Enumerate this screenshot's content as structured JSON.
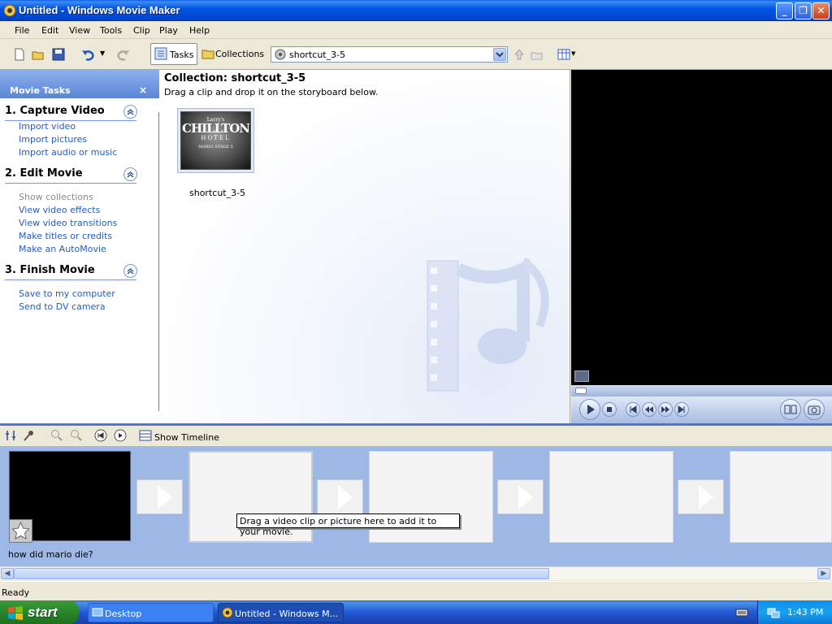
{
  "window": {
    "title": "Untitled - Windows Movie Maker",
    "controls": {
      "minimize": "_",
      "maximize": "❐",
      "close": "✕"
    }
  },
  "menu": [
    "File",
    "Edit",
    "View",
    "Tools",
    "Clip",
    "Play",
    "Help"
  ],
  "toolbar": {
    "tasks_label": "Tasks",
    "collections_label": "Collections",
    "collection_select": "shortcut_3-5"
  },
  "task_pane": {
    "title": "Movie Tasks",
    "close": "×",
    "sections": [
      {
        "title": "1. Capture Video",
        "links": [
          "Import video",
          "Import pictures",
          "Import audio or music"
        ]
      },
      {
        "title": "2. Edit Movie",
        "links": [
          "Show collections",
          "View video effects",
          "View video transitions",
          "Make titles or credits",
          "Make an AutoMovie"
        ]
      },
      {
        "title": "3. Finish Movie",
        "links": [
          "Save to my computer",
          "Send to DV camera"
        ]
      }
    ]
  },
  "collection": {
    "title": "Collection: shortcut_3-5",
    "hint": "Drag a clip and drop it on the storyboard below.",
    "clip_label": "shortcut_3-5",
    "thumb_text": {
      "line1": "Larry's",
      "line2": "CHILLTON",
      "line3": "HOTEL",
      "line4": "MARIO STAGE 5"
    }
  },
  "storyboard": {
    "toolbar_label": "Show Timeline",
    "tooltip": "Drag a video clip or picture here to add it to your movie.",
    "first_clip_label": "how did mario die?"
  },
  "status": {
    "text": "Ready"
  },
  "taskbar": {
    "start": "start",
    "items": [
      "Desktop",
      "Untitled - Windows M..."
    ],
    "clock": "1:43 PM"
  },
  "colors": {
    "title_bar": "#0055e5",
    "link": "#215dc6",
    "storyboard_bg": "#9eb8e6"
  }
}
